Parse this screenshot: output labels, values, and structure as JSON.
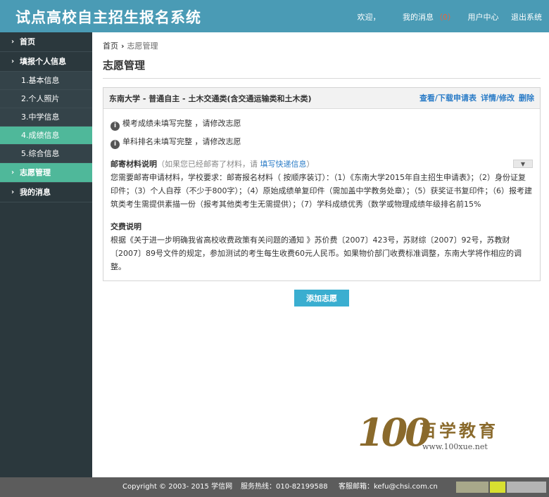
{
  "header": {
    "title": "试点高校自主招生报名系统",
    "welcome": "欢迎，",
    "messages_label": "我的消息",
    "messages_count": "（0）",
    "user_center": "用户中心",
    "logout": "退出系统"
  },
  "sidebar": {
    "items": [
      {
        "label": "首页",
        "type": "top"
      },
      {
        "label": "填报个人信息",
        "type": "top"
      },
      {
        "label": "1.基本信息",
        "type": "sub"
      },
      {
        "label": "2.个人照片",
        "type": "sub"
      },
      {
        "label": "3.中学信息",
        "type": "sub"
      },
      {
        "label": "4.成绩信息",
        "type": "sub"
      },
      {
        "label": "5.综合信息",
        "type": "sub"
      },
      {
        "label": "志愿管理",
        "type": "top"
      },
      {
        "label": "我的消息",
        "type": "top"
      }
    ],
    "chevron": "›"
  },
  "breadcrumb": {
    "home": "首页",
    "separator": "›",
    "current": "志愿管理"
  },
  "page_title": "志愿管理",
  "panel": {
    "title": "东南大学 - 普通自主 - 土木交通类(含交通运输类和土木类)",
    "actions": {
      "view_download": "查看/下载申请表",
      "edit": "详情/修改",
      "delete": "删除"
    },
    "warnings": [
      "模考成绩未填写完整 ，请修改志愿",
      "单科排名未填写完整 ，请修改志愿"
    ],
    "info_glyph": "i",
    "mail": {
      "title": "邮寄材料说明",
      "hint_prefix": "（如果您已经邮寄了材料，请 ",
      "hint_link": "填写快递信息",
      "hint_suffix": "）",
      "toggle_glyph": "▼",
      "text": "您需要邮寄申请材料，学校要求：邮寄报名材料（ 按顺序装订）：（1）《东南大学2015年自主招生申请表》；（2）身份证复印件；（3）个人自荐（不少于800字）；（4）原始成绩单复印件（需加盖中学教务处章）；（5）获奖证书复印件；（6）报考建筑类考生需提供素描一份（报考其他类考生无需提供）；（7）学科成绩优秀（数学或物理成绩年级排名前15%"
    },
    "fee": {
      "title": "交费说明",
      "text": "根据《关于进一步明确我省高校收费政策有关问题的通知 》苏价费〔2007〕423号，苏财综〔2007〕92号，苏教财〔2007〕89号文件的规定，参加测试的考生每生收费60元人民币。如果物价部门收费标准调整，东南大学将作相应的调整。"
    }
  },
  "add_button": "添加志愿",
  "watermark": {
    "number": "100",
    "text": "百学教育",
    "url": "www.100xue.net"
  },
  "footer": {
    "copyright": "Copyright © 2003- 2015 学信网",
    "hotline": "服务热线：010-82199588",
    "email": "客服邮箱：kefu@chsi.com.cn"
  },
  "colors": {
    "header_bg": "#4a9bb5",
    "sidebar_bg": "#2b383d",
    "active_bg": "#4fb89a",
    "link": "#2b7cc7",
    "button": "#3aaed0",
    "footer_bg": "#5c5c5c"
  }
}
